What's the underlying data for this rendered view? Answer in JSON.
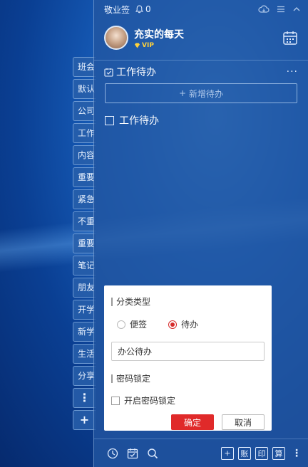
{
  "app": {
    "title": "敬业签",
    "notification_count": "0"
  },
  "user": {
    "name": "充实的每天",
    "badge": "VIP"
  },
  "side_tabs": [
    "班会",
    "默认",
    "公司",
    "工作",
    "内容",
    "重要",
    "紧急",
    "不重",
    "重要",
    "笔记",
    "朋友",
    "开学",
    "新学",
    "生活",
    "分享"
  ],
  "side_more_label": "⋮",
  "side_add_label": "+",
  "category": {
    "name": "工作待办",
    "more_label": "···"
  },
  "new_task": {
    "label": "新增待办"
  },
  "task": {
    "title": "工作待办"
  },
  "dialog": {
    "type_title": "分类类型",
    "option_note": "便签",
    "option_todo": "待办",
    "selected": "待办",
    "name_value": "办公待办",
    "lock_title": "密码锁定",
    "lock_label": "开启密码锁定",
    "confirm": "确定",
    "cancel": "取消"
  },
  "bottom": {
    "btn1": "账",
    "btn2": "印",
    "btn3": "算"
  },
  "colors": {
    "accent": "#e02a2a",
    "panel": "#2256a0",
    "vip": "#ffd23b"
  }
}
